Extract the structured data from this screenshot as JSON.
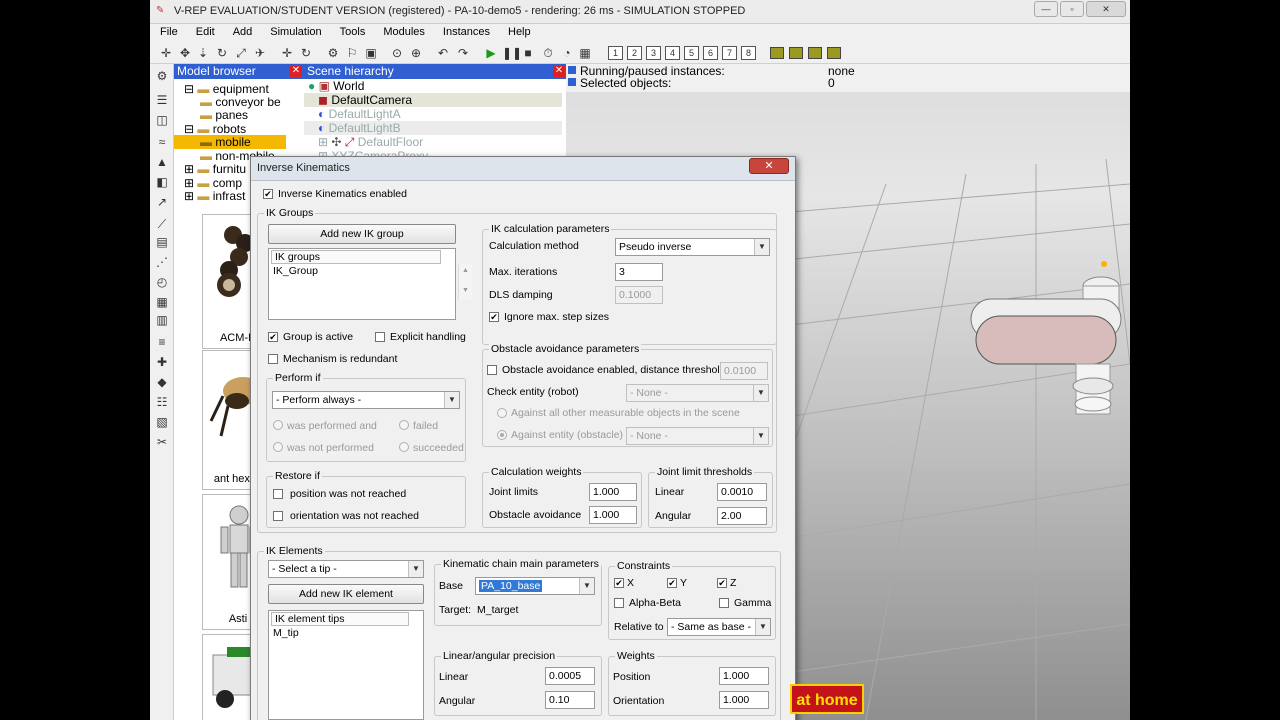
{
  "window": {
    "title": "V-REP EVALUATION/STUDENT VERSION (registered) - PA-10-demo5 - rendering: 26 ms - SIMULATION STOPPED",
    "minimize": "—",
    "maximize": "▫",
    "close": "✕"
  },
  "menu": [
    "File",
    "Edit",
    "Add",
    "Simulation",
    "Tools",
    "Modules",
    "Instances",
    "Help"
  ],
  "toolbar": {
    "page_buttons": [
      "1",
      "2",
      "3",
      "4",
      "5",
      "6",
      "7",
      "8"
    ],
    "layer_buttons": [
      "",
      "",
      "",
      ""
    ]
  },
  "model_browser": {
    "title": "Model browser",
    "tree": [
      {
        "label": "equipment",
        "indent": 0,
        "state": "normal"
      },
      {
        "label": "conveyor be",
        "indent": 1,
        "state": "normal"
      },
      {
        "label": "panes",
        "indent": 1,
        "state": "normal"
      },
      {
        "label": "robots",
        "indent": 0,
        "state": "normal"
      },
      {
        "label": "mobile",
        "indent": 1,
        "state": "selected"
      },
      {
        "label": "non-mobile",
        "indent": 1,
        "state": "normal"
      },
      {
        "label": "furnitu",
        "indent": 0,
        "state": "normal"
      },
      {
        "label": "comp",
        "indent": 0,
        "state": "normal"
      },
      {
        "label": "infrast",
        "indent": 0,
        "state": "normal"
      }
    ],
    "thumbnails": [
      "ACM-R",
      "ant hexap",
      "Asti",
      ""
    ]
  },
  "scene_hierarchy": {
    "title": "Scene hierarchy",
    "items": [
      {
        "label": "World",
        "state": "normal"
      },
      {
        "label": "DefaultCamera",
        "state": "normal"
      },
      {
        "label": "DefaultLightA",
        "state": "dim"
      },
      {
        "label": "DefaultLightB",
        "state": "dim"
      },
      {
        "label": "DefaultFloor",
        "state": "dim"
      },
      {
        "label": "XYZCameraProxy",
        "state": "dim"
      }
    ]
  },
  "info": {
    "running_label": "Running/paused instances:",
    "running_value": "none",
    "selected_label": "Selected objects:",
    "selected_value": "0"
  },
  "ik_dialog": {
    "title": "Inverse Kinematics",
    "ik_enabled_label": "Inverse Kinematics enabled",
    "ik_groups": {
      "group_label": "IK Groups",
      "add_button": "Add new IK group",
      "list_header": "IK groups",
      "list_items": [
        "IK_Group"
      ],
      "group_active_label": "Group is active",
      "explicit_handling_label": "Explicit handling",
      "mechanism_redundant_label": "Mechanism is redundant",
      "perform_if": {
        "label": "Perform if",
        "combo": "- Perform always -",
        "was_performed_and": "was performed and",
        "failed": "failed",
        "was_not_performed": "was not performed",
        "succeeded": "succeeded"
      },
      "restore_if": {
        "label": "Restore if",
        "position_not_reached": "position was not reached",
        "orientation_not_reached": "orientation was not reached"
      }
    },
    "calc_params": {
      "label": "IK calculation parameters",
      "method_label": "Calculation method",
      "method_value": "Pseudo inverse",
      "max_iter_label": "Max. iterations",
      "max_iter_value": "3",
      "dls_label": "DLS damping",
      "dls_value": "0.1000",
      "ignore_step_label": "Ignore max. step sizes"
    },
    "obstacle": {
      "label": "Obstacle avoidance parameters",
      "enabled_label": "Obstacle avoidance enabled, distance threshold",
      "threshold_value": "0.0100",
      "check_entity_label": "Check entity (robot)",
      "check_entity_value": "- None -",
      "against_all_label": "Against all other measurable objects in the scene",
      "against_entity_label": "Against entity (obstacle)",
      "against_entity_value": "- None -"
    },
    "calc_weights": {
      "label": "Calculation weights",
      "joint_limits_label": "Joint limits",
      "joint_limits_value": "1.000",
      "obstacle_label": "Obstacle avoidance",
      "obstacle_value": "1.000"
    },
    "joint_thresholds": {
      "label": "Joint limit thresholds",
      "linear_label": "Linear",
      "linear_value": "0.0010",
      "angular_label": "Angular",
      "angular_value": "2.00"
    },
    "ik_elements": {
      "label": "IK Elements",
      "tip_combo": "- Select a tip -",
      "add_button": "Add new IK element",
      "list_header": "IK element tips",
      "list_items": [
        "M_tip"
      ]
    },
    "chain": {
      "label": "Kinematic chain main parameters",
      "base_label": "Base",
      "base_value": "PA_10_base",
      "target_label": "Target:",
      "target_value": "M_target"
    },
    "constraints": {
      "label": "Constraints",
      "x": "X",
      "y": "Y",
      "z": "Z",
      "alpha_beta": "Alpha-Beta",
      "gamma": "Gamma",
      "relative_label": "Relative to",
      "relative_value": "- Same as base -"
    },
    "precision": {
      "label": "Linear/angular precision",
      "linear_label": "Linear",
      "linear_value": "0.0005",
      "angular_label": "Angular",
      "angular_value": "0.10"
    },
    "weights": {
      "label": "Weights",
      "position_label": "Position",
      "position_value": "1.000",
      "orientation_label": "Orientation",
      "orientation_value": "1.000"
    },
    "close": "✕"
  },
  "overlay_badge": "at home",
  "colors": {
    "panel_header": "#2f5fd0",
    "selection": "#f5b800",
    "badge_bg": "#c3121a",
    "badge_text": "#ffe000"
  }
}
